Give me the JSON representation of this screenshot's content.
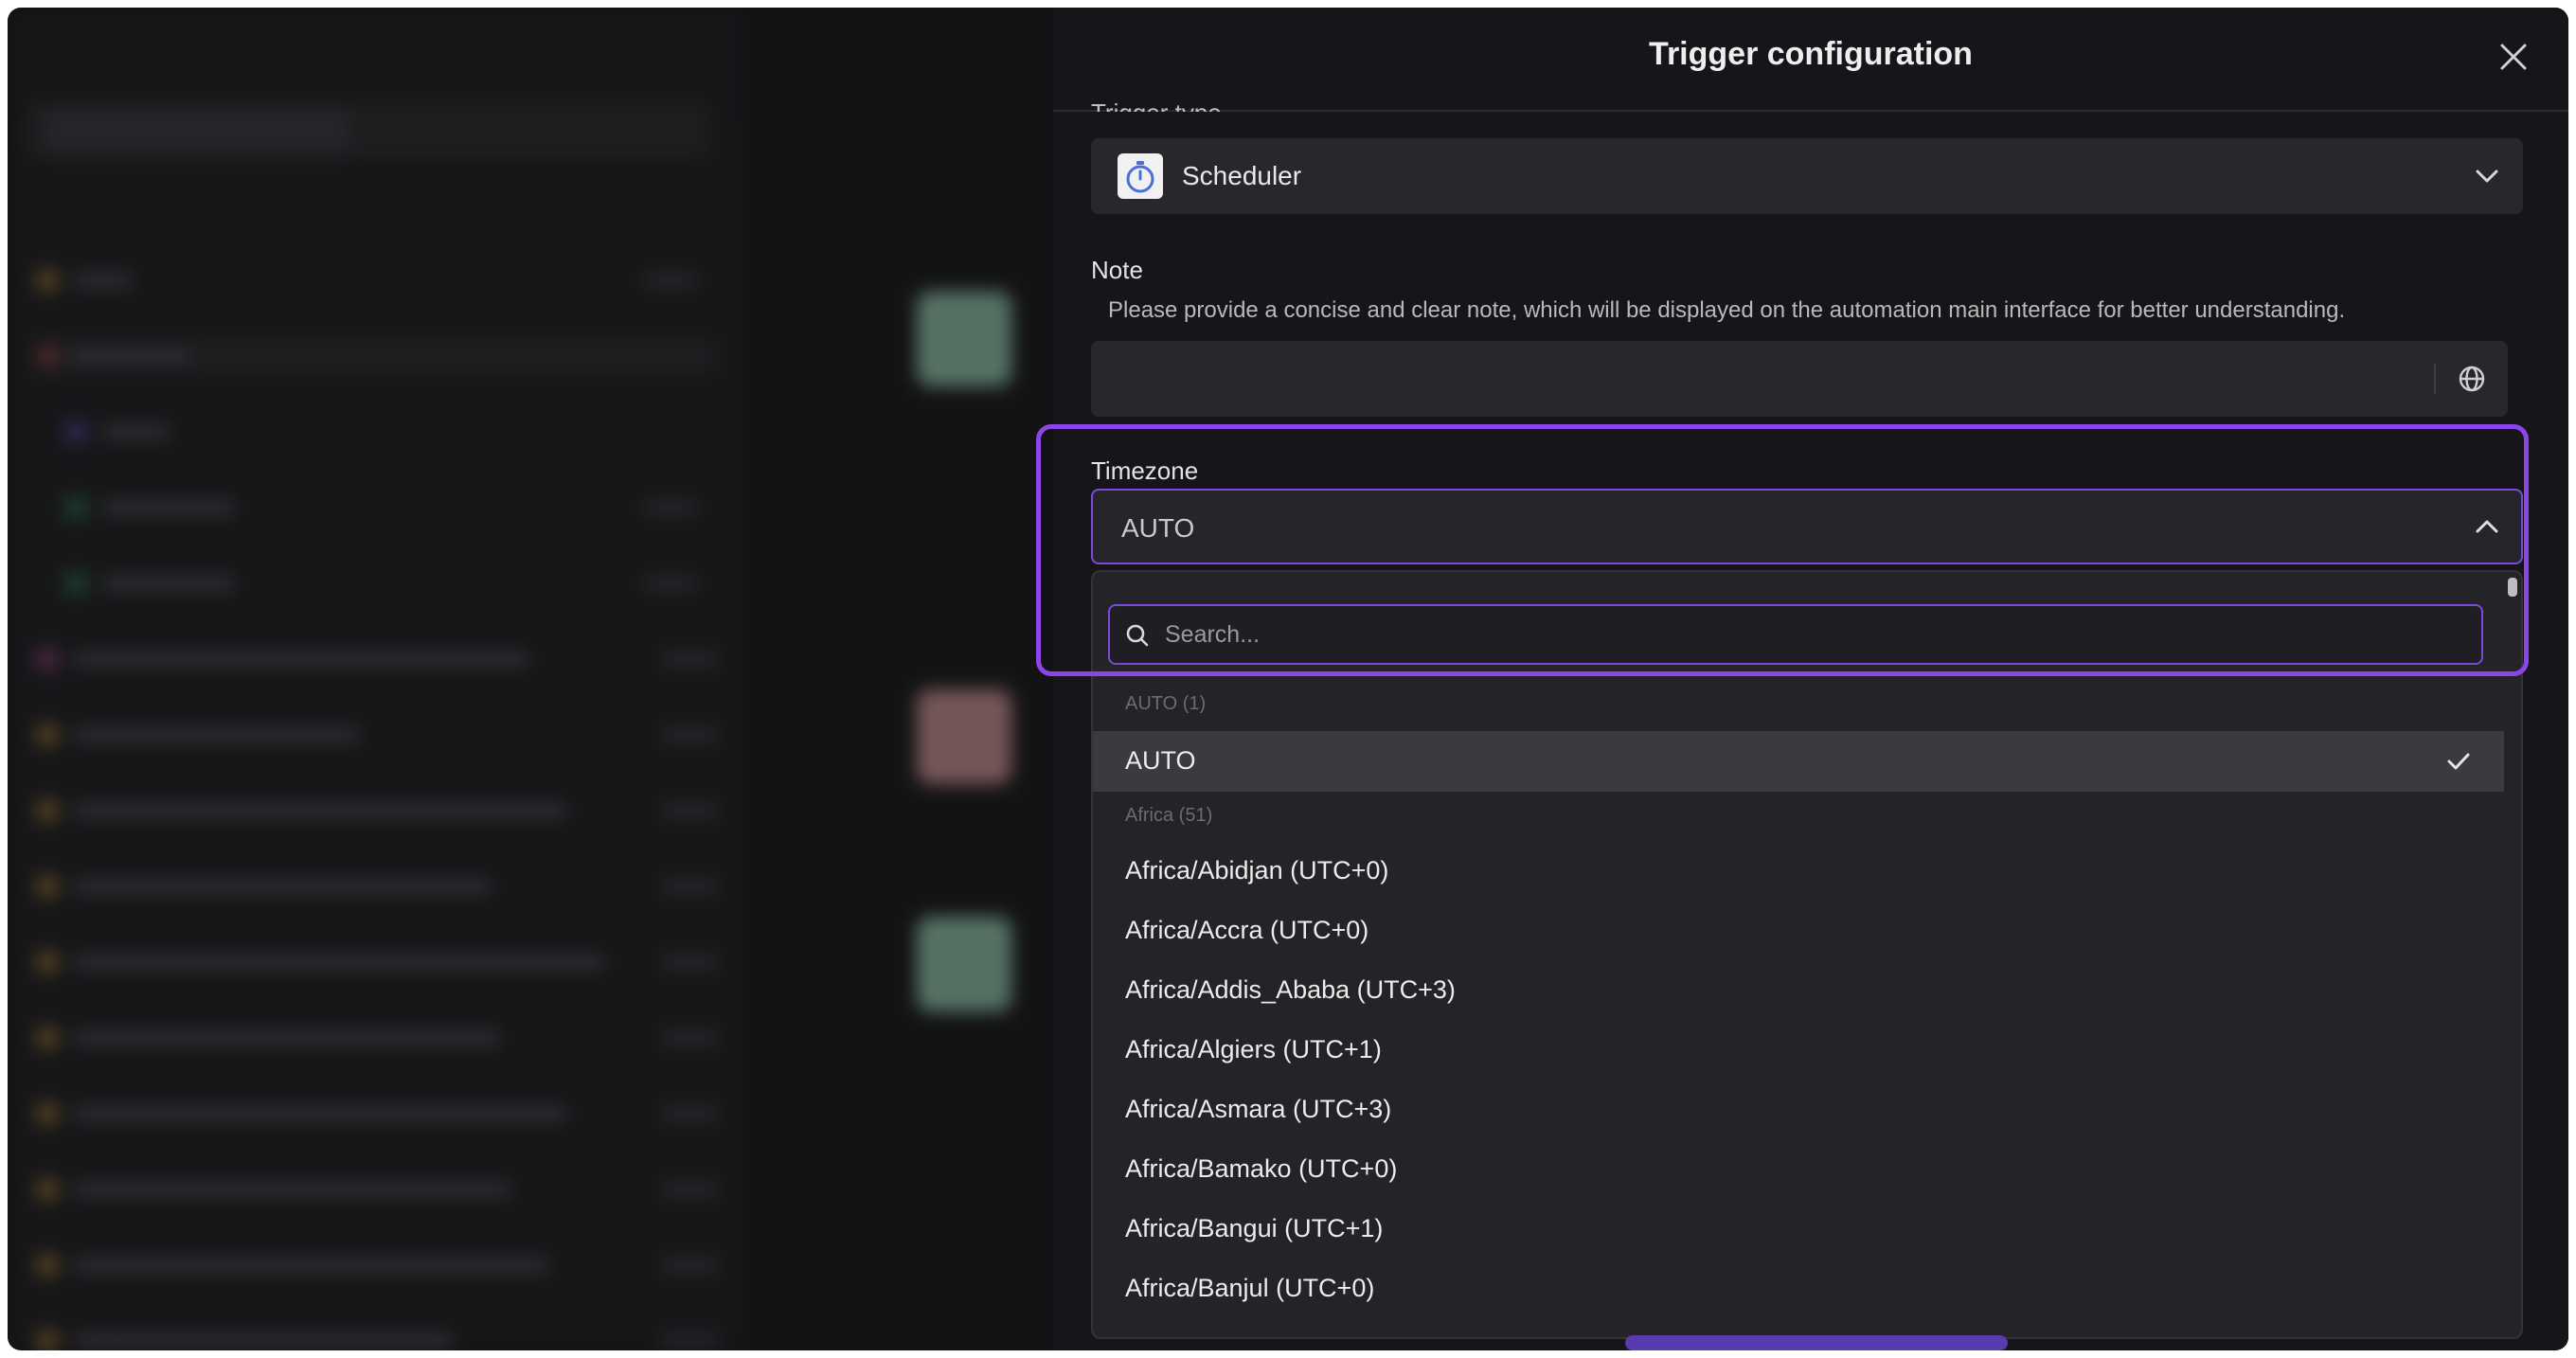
{
  "dialog": {
    "title": "Trigger configuration",
    "close_icon": "close-icon"
  },
  "trigger_type": {
    "label": "Trigger type",
    "value": "Scheduler",
    "icon": "stopwatch-icon"
  },
  "note": {
    "label": "Note",
    "description": "Please provide a concise and clear note, which will be displayed on the automation main interface for better understanding.",
    "value": "",
    "icon": "globe-icon"
  },
  "timezone": {
    "label": "Timezone",
    "value": "AUTO",
    "search_placeholder": "Search...",
    "groups": [
      {
        "header": "AUTO (1)",
        "options": [
          "AUTO"
        ]
      },
      {
        "header": "Africa (51)",
        "options": [
          "Africa/Abidjan (UTC+0)",
          "Africa/Accra (UTC+0)",
          "Africa/Addis_Ababa (UTC+3)",
          "Africa/Algiers (UTC+1)",
          "Africa/Asmara (UTC+3)",
          "Africa/Bamako (UTC+0)",
          "Africa/Bangui (UTC+1)",
          "Africa/Banjul (UTC+0)"
        ]
      }
    ],
    "selected": "AUTO"
  },
  "colors": {
    "accent": "#8b45e8",
    "dialog_bg": "#16161a",
    "input_bg": "#28282c"
  }
}
